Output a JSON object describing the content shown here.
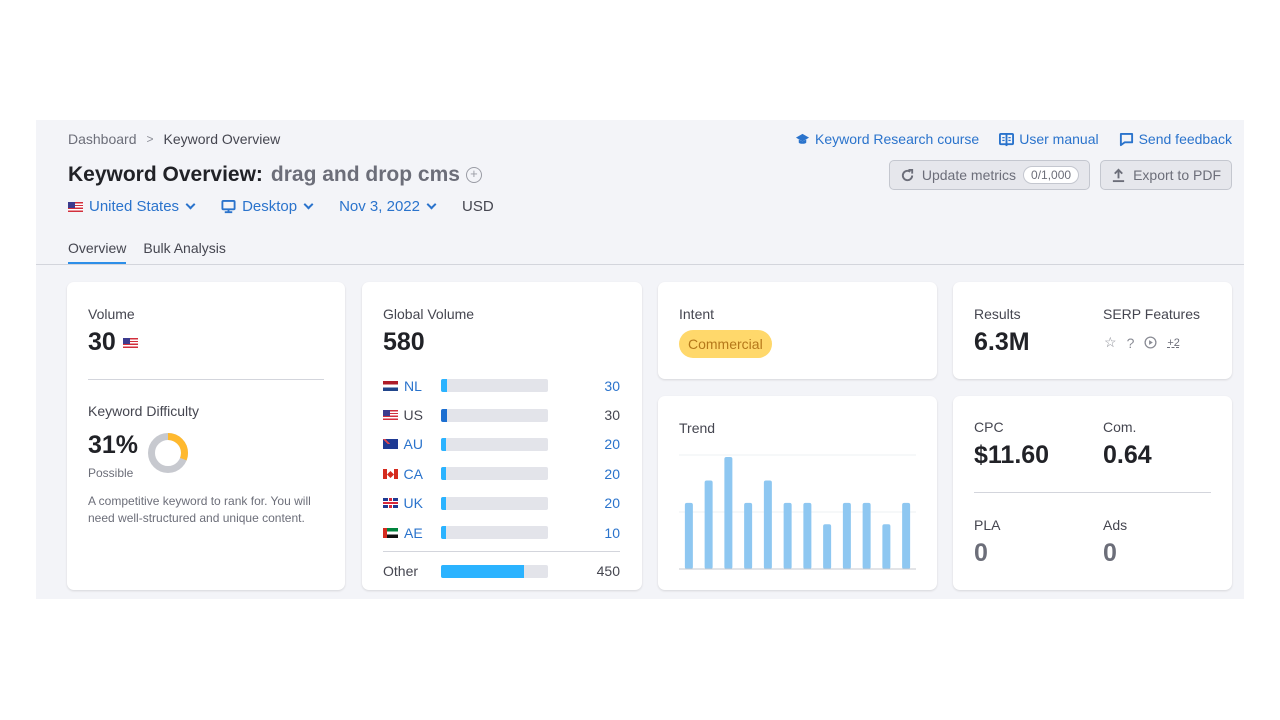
{
  "breadcrumb": {
    "items": [
      "Dashboard",
      "Keyword Overview"
    ],
    "separator": ">"
  },
  "top_links": [
    {
      "label": "Keyword Research course",
      "icon": "graduation-cap-icon"
    },
    {
      "label": "User manual",
      "icon": "book-icon"
    },
    {
      "label": "Send feedback",
      "icon": "chat-bubble-icon"
    }
  ],
  "header": {
    "title": "Keyword Overview:",
    "keyword": "drag and drop cms",
    "add_icon": "plus-circle-icon"
  },
  "actions": {
    "update_label": "Update metrics",
    "update_counter": "0/1,000",
    "export_label": "Export to PDF"
  },
  "filters": {
    "country": "United States",
    "device": "Desktop",
    "date": "Nov 3, 2022",
    "currency": "USD"
  },
  "tabs": [
    {
      "label": "Overview",
      "active": true
    },
    {
      "label": "Bulk Analysis",
      "active": false
    }
  ],
  "volume": {
    "label": "Volume",
    "value": "30",
    "flag": "US"
  },
  "keyword_difficulty": {
    "label": "Keyword Difficulty",
    "value": "31%",
    "percent": 31,
    "rating": "Possible",
    "description": "A competitive keyword to rank for. You will need well-structured and unique content.",
    "colors": {
      "fill": "#ffb92e",
      "track": "#c7c9cf"
    }
  },
  "global_volume": {
    "label": "Global Volume",
    "value": "580",
    "countries": [
      {
        "code": "NL",
        "value": "30",
        "share": 0.052
      },
      {
        "code": "US",
        "value": "30",
        "share": 0.052
      },
      {
        "code": "AU",
        "value": "20",
        "share": 0.034
      },
      {
        "code": "CA",
        "value": "20",
        "share": 0.034
      },
      {
        "code": "UK",
        "value": "20",
        "share": 0.034
      },
      {
        "code": "AE",
        "value": "10",
        "share": 0.017
      }
    ],
    "other": {
      "label": "Other",
      "value": "450",
      "share": 0.776
    }
  },
  "intent": {
    "label": "Intent",
    "value": "Commercial",
    "color": "#ffd86b"
  },
  "trend": {
    "label": "Trend",
    "relative_values": [
      0.59,
      0.79,
      1.0,
      0.59,
      0.79,
      0.59,
      0.59,
      0.4,
      0.59,
      0.59,
      0.4,
      0.59
    ],
    "bar_color": "#8ec7f1"
  },
  "results": {
    "label": "Results",
    "value": "6.3M"
  },
  "serp_features": {
    "label": "SERP Features",
    "icons": [
      "star-icon",
      "question-icon",
      "video-play-icon"
    ],
    "more": "+2"
  },
  "cpc": {
    "label": "CPC",
    "value": "$11.60"
  },
  "competition": {
    "label": "Com.",
    "value": "0.64"
  },
  "pla": {
    "label": "PLA",
    "value": "0"
  },
  "ads": {
    "label": "Ads",
    "value": "0"
  }
}
